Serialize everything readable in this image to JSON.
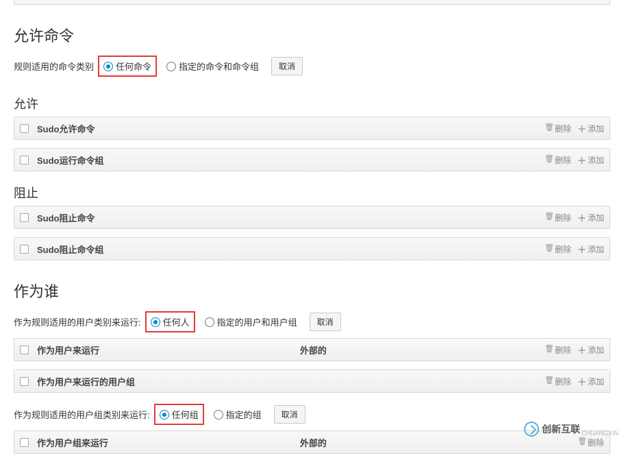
{
  "allow": {
    "title": "允许命令",
    "category_label": "规则适用的命令类别",
    "radio_any": "任何命令",
    "radio_specified": "指定的命令和命令组",
    "cancel": "取消",
    "sub_allow": "允许",
    "panel1_title": "Sudo允许命令",
    "panel2_title": "Sudo运行命令组",
    "sub_block": "阻止",
    "panel3_title": "Sudo阻止命令",
    "panel4_title": "Sudo阻止命令组"
  },
  "aswho": {
    "title": "作为谁",
    "user_label": "作为规则适用的用户类别来运行:",
    "radio_anyone": "任何人",
    "radio_specified_user": "指定的用户和用户组",
    "cancel": "取消",
    "panel5_col1": "作为用户来运行",
    "panel5_col2": "外部的",
    "panel6_title": "作为用户来运行的用户组",
    "group_label": "作为规则适用的用户组类别来运行:",
    "radio_anygroup": "任何组",
    "radio_specified_group": "指定的组",
    "panel7_col1": "作为用户组来运行",
    "panel7_col2": "外部的"
  },
  "actions": {
    "delete": "删除",
    "add": "添加"
  },
  "watermark": {
    "brand": "创新互联",
    "sub": "CHUANGXIN"
  }
}
